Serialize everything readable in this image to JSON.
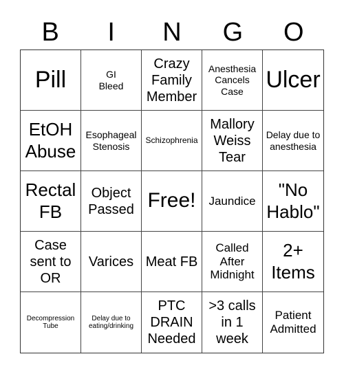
{
  "header": {
    "letters": [
      "B",
      "I",
      "N",
      "G",
      "O"
    ]
  },
  "cells": [
    [
      "Pill",
      "GI Bleed",
      "Crazy Family Member",
      "Anesthesia Cancels Case",
      "Ulcer"
    ],
    [
      "EtOH Abuse",
      "Esophageal Stenosis",
      "Schizophrenia",
      "Mallory Weiss Tear",
      "Delay due to anesthesia"
    ],
    [
      "Rectal FB",
      "Object Passed",
      "Free!",
      "Jaundice",
      "\"No Hablo\""
    ],
    [
      "Case sent to OR",
      "Varices",
      "Meat FB",
      "Called After Midnight",
      "2+ Items"
    ],
    [
      "Decompression Tube",
      "Delay due to eating/drinking",
      "PTC DRAIN Needed",
      ">3 calls in 1 week",
      "Patient Admitted"
    ]
  ]
}
